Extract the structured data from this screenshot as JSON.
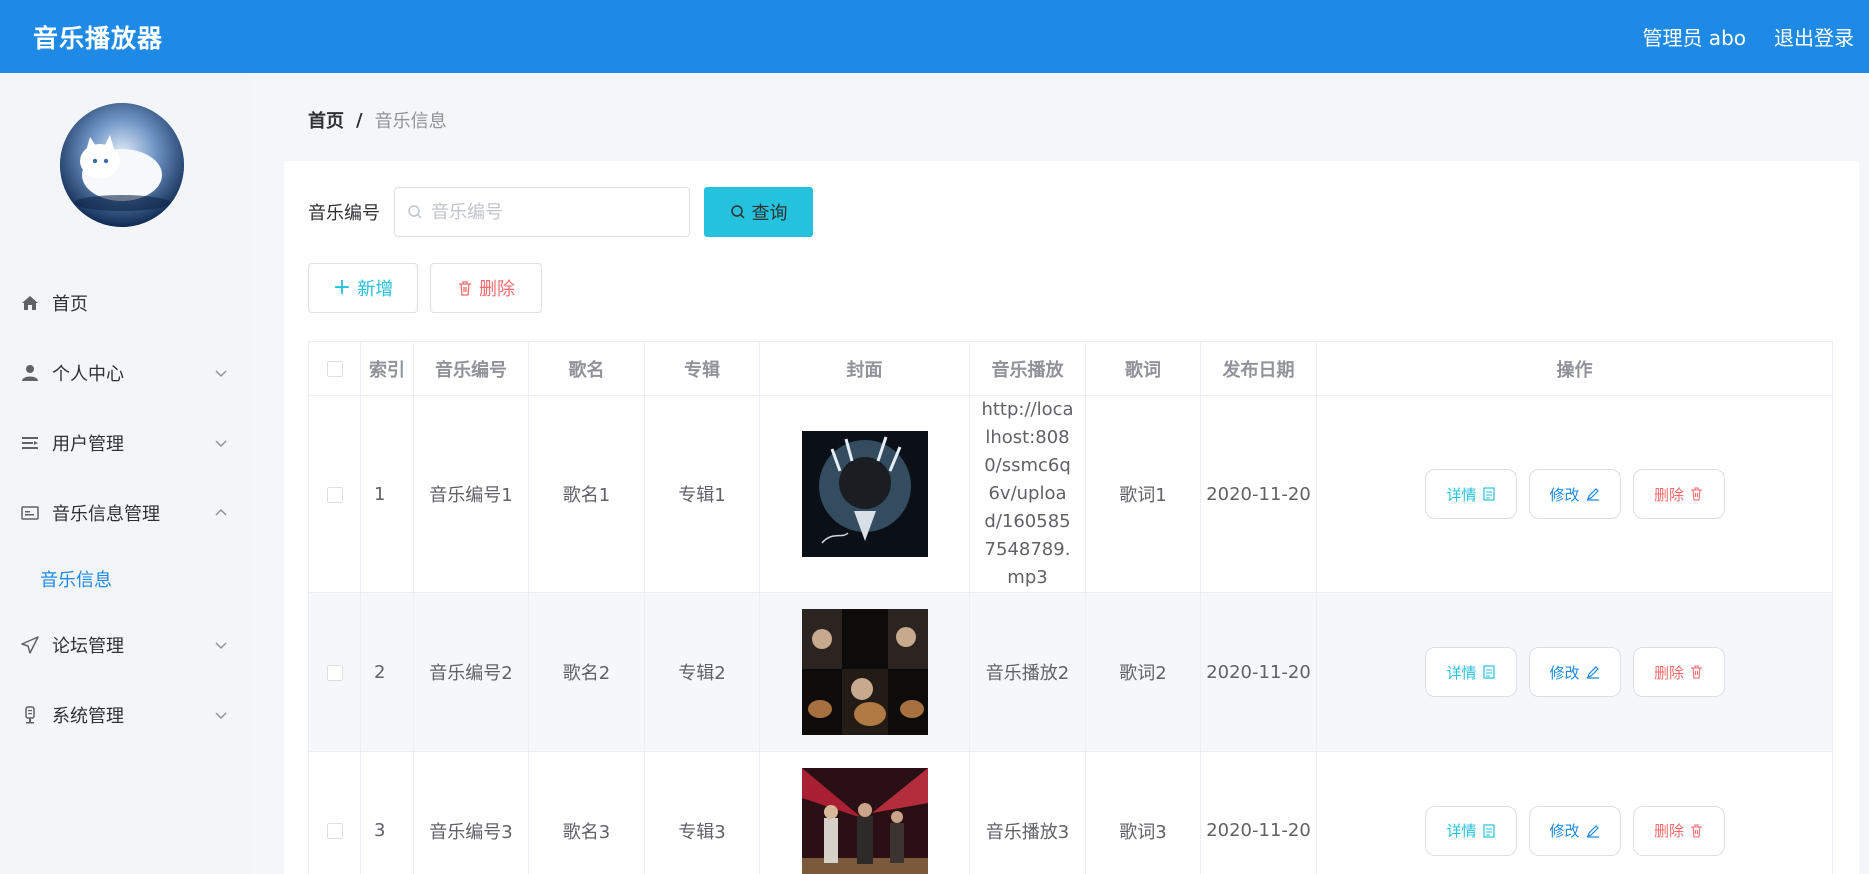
{
  "header": {
    "title": "音乐播放器",
    "user": "管理员 abo",
    "logout": "退出登录"
  },
  "sidebar": {
    "items": [
      {
        "label": "首页",
        "icon": "home-icon"
      },
      {
        "label": "个人中心",
        "icon": "user-icon"
      },
      {
        "label": "用户管理",
        "icon": "list-icon"
      },
      {
        "label": "音乐信息管理",
        "icon": "card-icon",
        "expanded": true
      },
      {
        "label": "论坛管理",
        "icon": "send-icon"
      },
      {
        "label": "系统管理",
        "icon": "mic-icon"
      }
    ],
    "sub_item": "音乐信息"
  },
  "breadcrumb": {
    "home": "首页",
    "separator": "/",
    "current": "音乐信息"
  },
  "search": {
    "label": "音乐编号",
    "placeholder": "音乐编号",
    "button": "查询"
  },
  "actions": {
    "add": "新增",
    "delete": "删除"
  },
  "table": {
    "headers": [
      "",
      "索引",
      "音乐编号",
      "歌名",
      "专辑",
      "封面",
      "音乐播放",
      "歌词",
      "发布日期",
      "操作"
    ],
    "rows": [
      {
        "index": "1",
        "code": "音乐编号1",
        "name": "歌名1",
        "album": "专辑1",
        "play": "http://localhost:8080/ssmc6q6v/upload/1605857548789.mp3",
        "lyrics": "歌词1",
        "date": "2020-11-20"
      },
      {
        "index": "2",
        "code": "音乐编号2",
        "name": "歌名2",
        "album": "专辑2",
        "play": "音乐播放2",
        "lyrics": "歌词2",
        "date": "2020-11-20"
      },
      {
        "index": "3",
        "code": "音乐编号3",
        "name": "歌名3",
        "album": "专辑3",
        "play": "音乐播放3",
        "lyrics": "歌词3",
        "date": "2020-11-20"
      }
    ],
    "ops": {
      "detail": "详情",
      "edit": "修改",
      "delete": "删除"
    }
  },
  "colors": {
    "primary": "#1f8ae6",
    "cyan": "#25c2dd",
    "danger": "#f56c6c"
  }
}
